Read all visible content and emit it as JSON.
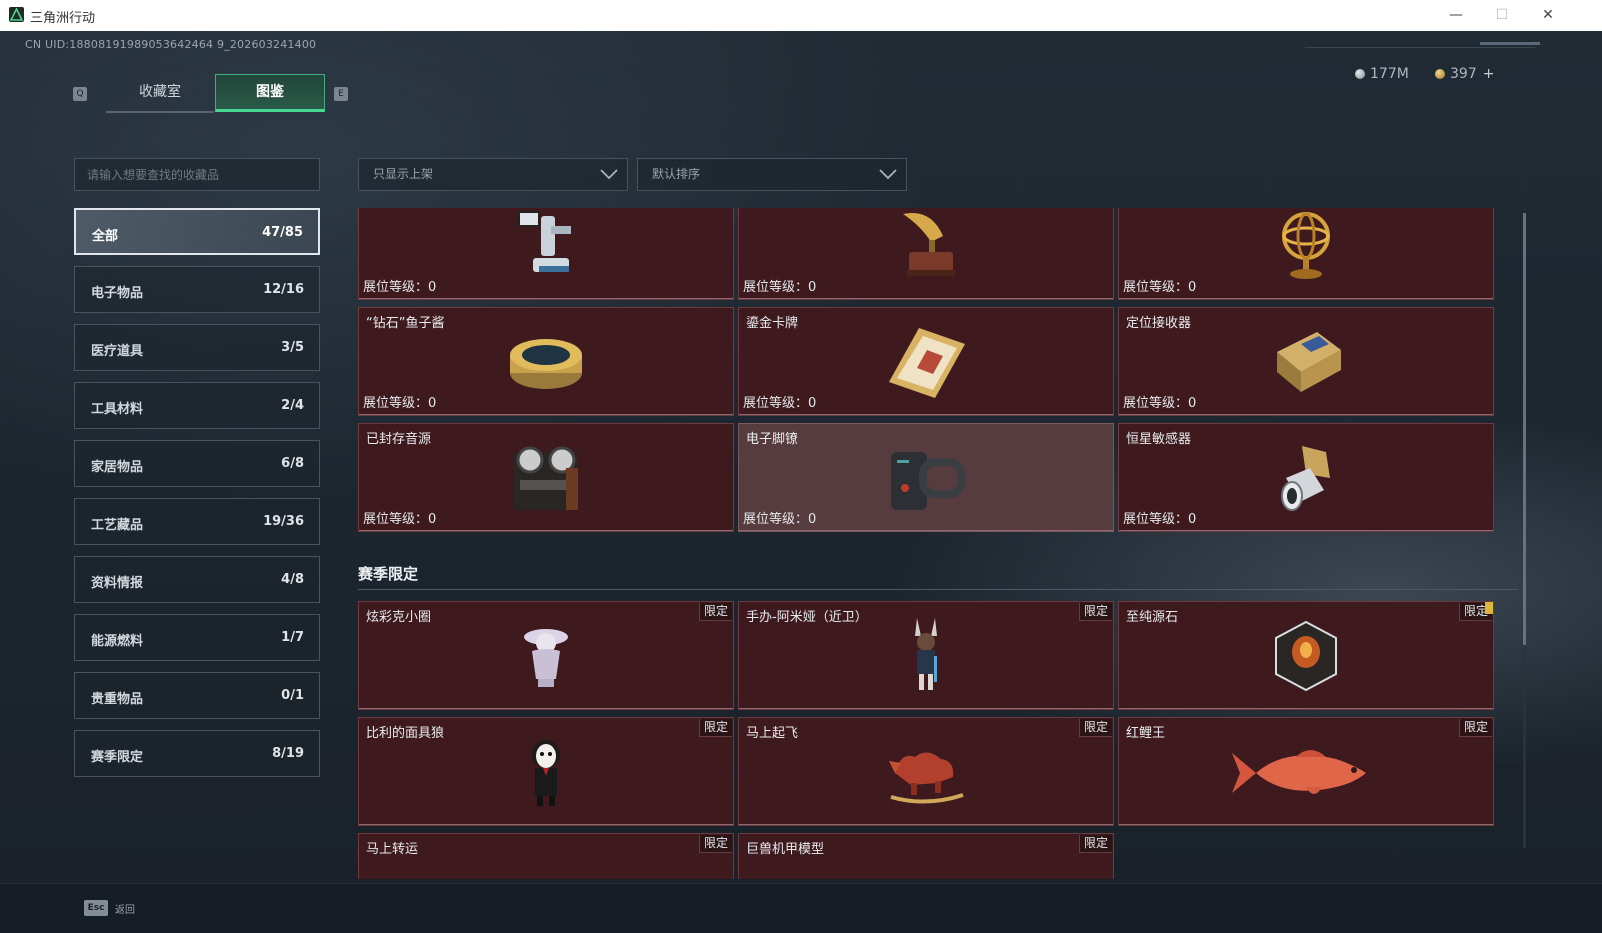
{
  "window": {
    "title": "三角洲行动",
    "minimize": "—",
    "maximize": "☐",
    "close": "✕"
  },
  "uid": "CN UID:18808191989053642464 9_202603241400",
  "tabs": {
    "left_key": "Q",
    "right_key": "E",
    "items": [
      {
        "label": "收藏室"
      },
      {
        "label": "图鉴"
      }
    ],
    "active": "图鉴"
  },
  "currency": {
    "silver": "177M",
    "gold": "397",
    "plus": "+"
  },
  "search": {
    "placeholder": "请输入想要查找的收藏品"
  },
  "filters": {
    "availability": "只显示上架",
    "sort": "默认排序"
  },
  "categories": [
    {
      "name": "全部",
      "count": "47/85",
      "selected": true
    },
    {
      "name": "电子物品",
      "count": "12/16"
    },
    {
      "name": "医疗道具",
      "count": "3/5"
    },
    {
      "name": "工具材料",
      "count": "2/4"
    },
    {
      "name": "家居物品",
      "count": "6/8"
    },
    {
      "name": "工艺藏品",
      "count": "19/36"
    },
    {
      "name": "资料情报",
      "count": "4/8"
    },
    {
      "name": "能源燃料",
      "count": "1/7"
    },
    {
      "name": "贵重物品",
      "count": "0/1"
    },
    {
      "name": "赛季限定",
      "count": "8/19"
    }
  ],
  "collection": {
    "level_label": "展位等级：",
    "items": [
      {
        "name": "",
        "level": "0",
        "icon": "robotic-arm-icon"
      },
      {
        "name": "",
        "level": "0",
        "icon": "gramophone-icon"
      },
      {
        "name": "",
        "level": "0",
        "icon": "armillary-sphere-icon"
      },
      {
        "name": "“钻石”鱼子酱",
        "level": "0",
        "icon": "caviar-tin-icon"
      },
      {
        "name": "鎏金卡牌",
        "level": "0",
        "icon": "gilded-card-icon"
      },
      {
        "name": "定位接收器",
        "level": "0",
        "icon": "receiver-device-icon"
      },
      {
        "name": "已封存音源",
        "level": "0",
        "icon": "reel-recorder-icon"
      },
      {
        "name": "电子脚镣",
        "level": "0",
        "icon": "ankle-monitor-icon"
      },
      {
        "name": "恒星敏感器",
        "level": "0",
        "icon": "star-sensor-icon"
      }
    ]
  },
  "season": {
    "title": "赛季限定",
    "limit_label": "限定",
    "items": [
      {
        "name": "炫彩克小圈",
        "icon": "figurine-hat-icon"
      },
      {
        "name": "手办-阿米娅（近卫）",
        "icon": "amiya-figure-icon"
      },
      {
        "name": "至纯源石",
        "icon": "originium-crystal-icon"
      },
      {
        "name": "比利的面具狼",
        "icon": "billy-puppet-icon"
      },
      {
        "name": "马上起飞",
        "icon": "rocking-horse-icon"
      },
      {
        "name": "红鲤王",
        "icon": "red-carp-icon"
      },
      {
        "name": "马上转运"
      },
      {
        "name": "巨兽机甲模型"
      }
    ]
  },
  "footer": {
    "esc": "Esc",
    "back": "返回"
  }
}
